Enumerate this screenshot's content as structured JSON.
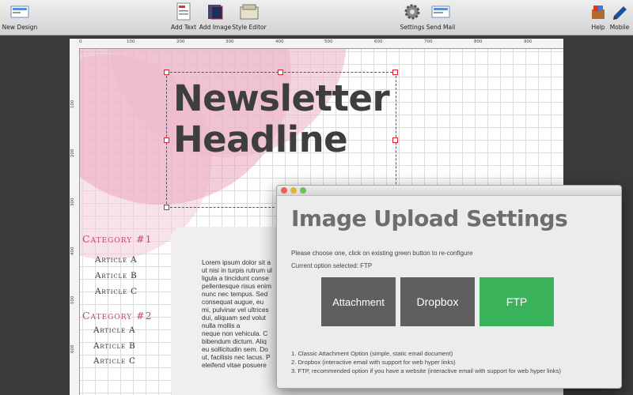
{
  "toolbar": {
    "new_design": "New Design",
    "add_text": "Add Text",
    "add_image": "Add Image",
    "style_editor": "Style Editor",
    "settings": "Settings",
    "send_mail": "Send Mail",
    "help": "Help",
    "mobile": "Mobile"
  },
  "rulers": {
    "top": [
      "0",
      "100",
      "200",
      "300",
      "400",
      "500",
      "600",
      "700",
      "800",
      "900"
    ],
    "left": [
      "100",
      "200",
      "300",
      "400",
      "500",
      "600"
    ]
  },
  "design": {
    "headline_line1": "Newsletter",
    "headline_line2": "Headline",
    "category1": "Category #1",
    "category2": "Category #2",
    "articles1": [
      "Article A",
      "Article B",
      "Article C"
    ],
    "articles2": [
      "Article A",
      "Article B",
      "Article C"
    ],
    "lorem": [
      "Lorem ipsum dolor sit a",
      "ut nisi in turpis rutrum ul",
      "ligula a tincidunt conse",
      "pellentesque risus enim",
      "nunc nec tempus. Sed",
      "consequat augue, eu",
      "mi, pulvinar vel ultrices",
      "dui, aliquam sed volut",
      "nulla mollis a",
      "neque non vehicula. C",
      "bibendum dictum. Aliq",
      "eu sollicitudin sem. Do",
      "ut, facilisis nec lacus. P",
      "eleifend vitae posuere"
    ]
  },
  "dialog": {
    "title": "Image Upload Settings",
    "instruction": "Please choose one, click on existing green button to re-configure",
    "current": "Current option selected: FTP",
    "buttons": [
      "Attachment",
      "Dropbox",
      "FTP"
    ],
    "notes": [
      "1. Classic Attachment Option (simple, static email document)",
      "2. Dropbox (interactive email with support for web hyper links)",
      "3. FTP, recommended option if you have a website (interactive email with support for web hyper links)"
    ]
  },
  "colors": {
    "accent_green": "#3bb35a",
    "button_gray": "#5f5f5f",
    "category_pink": "#c2477a"
  }
}
